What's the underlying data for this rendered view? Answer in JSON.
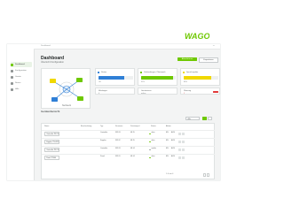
{
  "brand": {
    "name": "WAGO",
    "accent": "#6ec800"
  },
  "sidebar": {
    "items": [
      {
        "label": "Dashboard",
        "icon": "dashboard-icon",
        "active": true
      },
      {
        "label": "Konfiguration",
        "icon": "settings-icon",
        "active": false
      },
      {
        "label": "Geräte",
        "icon": "device-icon",
        "active": false
      },
      {
        "label": "Nutzer",
        "icon": "user-icon",
        "active": false
      },
      {
        "label": "Hilfe",
        "icon": "help-icon",
        "active": false
      }
    ]
  },
  "topbar": {
    "breadcrumb": "Dashboard",
    "corner": "•••"
  },
  "header": {
    "title": "Dashboard",
    "subtitle": "Übersicht Konfiguration",
    "primary_button": "Aktualisieren",
    "secondary_button": "Exportieren"
  },
  "diagram": {
    "label": "Netzwerk"
  },
  "cards": [
    {
      "title": "Status",
      "value": "OK",
      "level": 0.75,
      "color": "#2f7fd6"
    },
    {
      "title": "Verbindungen / Netzwerk",
      "value": "92%",
      "level": 0.92,
      "color": "#6ec800"
    },
    {
      "title": "Speicherplatz",
      "value": "80%",
      "level": 0.8,
      "color": "#f0d800"
    },
    {
      "title": "Meldungen",
      "value": "0"
    },
    {
      "title": "Gerätestatus",
      "value": "online"
    },
    {
      "title": "Warnung",
      "value": "1",
      "color": "#e13a3a"
    }
  ],
  "section": {
    "title": "Geräteübersicht"
  },
  "filter": {
    "value": "Alle",
    "icons": [
      "list-view-icon",
      "grid-view-icon"
    ]
  },
  "table": {
    "columns": [
      "Name",
      "Beschreibung",
      "Typ",
      "Firmware",
      "Zeitstempel",
      "Status",
      "Aktion"
    ],
    "rows": [
      {
        "name": "Controller PFC200",
        "type": "Controller",
        "firmware": "FW 03",
        "time": "08:15",
        "status": "aktiv",
        "status_color": "#6ec800",
        "action": "EN",
        "action2": "AUS"
      },
      {
        "name": "Koppler 750-352",
        "type": "Koppler",
        "firmware": "FW 02",
        "time": "08:15",
        "status": "aktiv",
        "status_color": "#6ec800",
        "action": "EN",
        "action2": "AUS"
      },
      {
        "name": "Controller PFC100",
        "type": "Controller",
        "firmware": "FW 03",
        "time": "08:14",
        "status": "inaktiv",
        "status_color": "#9aa0a0",
        "action": "EN",
        "action2": "AUS"
      },
      {
        "name": "Panel TP600",
        "type": "Panel",
        "firmware": "FW 01",
        "time": "08:14",
        "status": "aktiv",
        "status_color": "#6ec800",
        "action": "EN",
        "action2": "AUS"
      }
    ],
    "pager": "1–4 von 4"
  }
}
